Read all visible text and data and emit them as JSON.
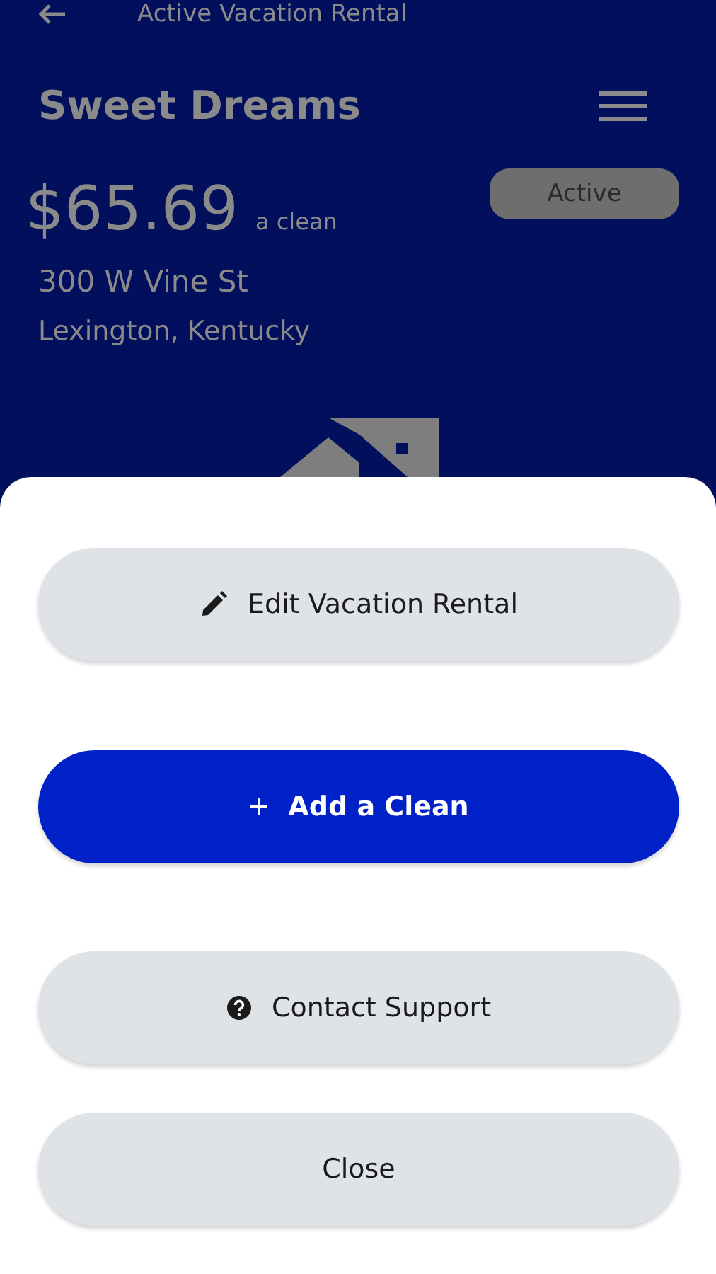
{
  "app_bar": {
    "title": "Active Vacation Rental"
  },
  "rental": {
    "name": "Sweet Dreams",
    "price": "$65.69",
    "price_unit": "a clean",
    "status": "Active",
    "street": "300 W Vine St",
    "city": "Lexington, Kentucky"
  },
  "sheet": {
    "buttons": [
      {
        "label": "Edit Vacation Rental",
        "kind": "edit"
      },
      {
        "label": "Add a Clean",
        "kind": "add"
      },
      {
        "label": "Contact Support",
        "kind": "help"
      },
      {
        "label": "Close",
        "kind": "plain"
      }
    ]
  }
}
